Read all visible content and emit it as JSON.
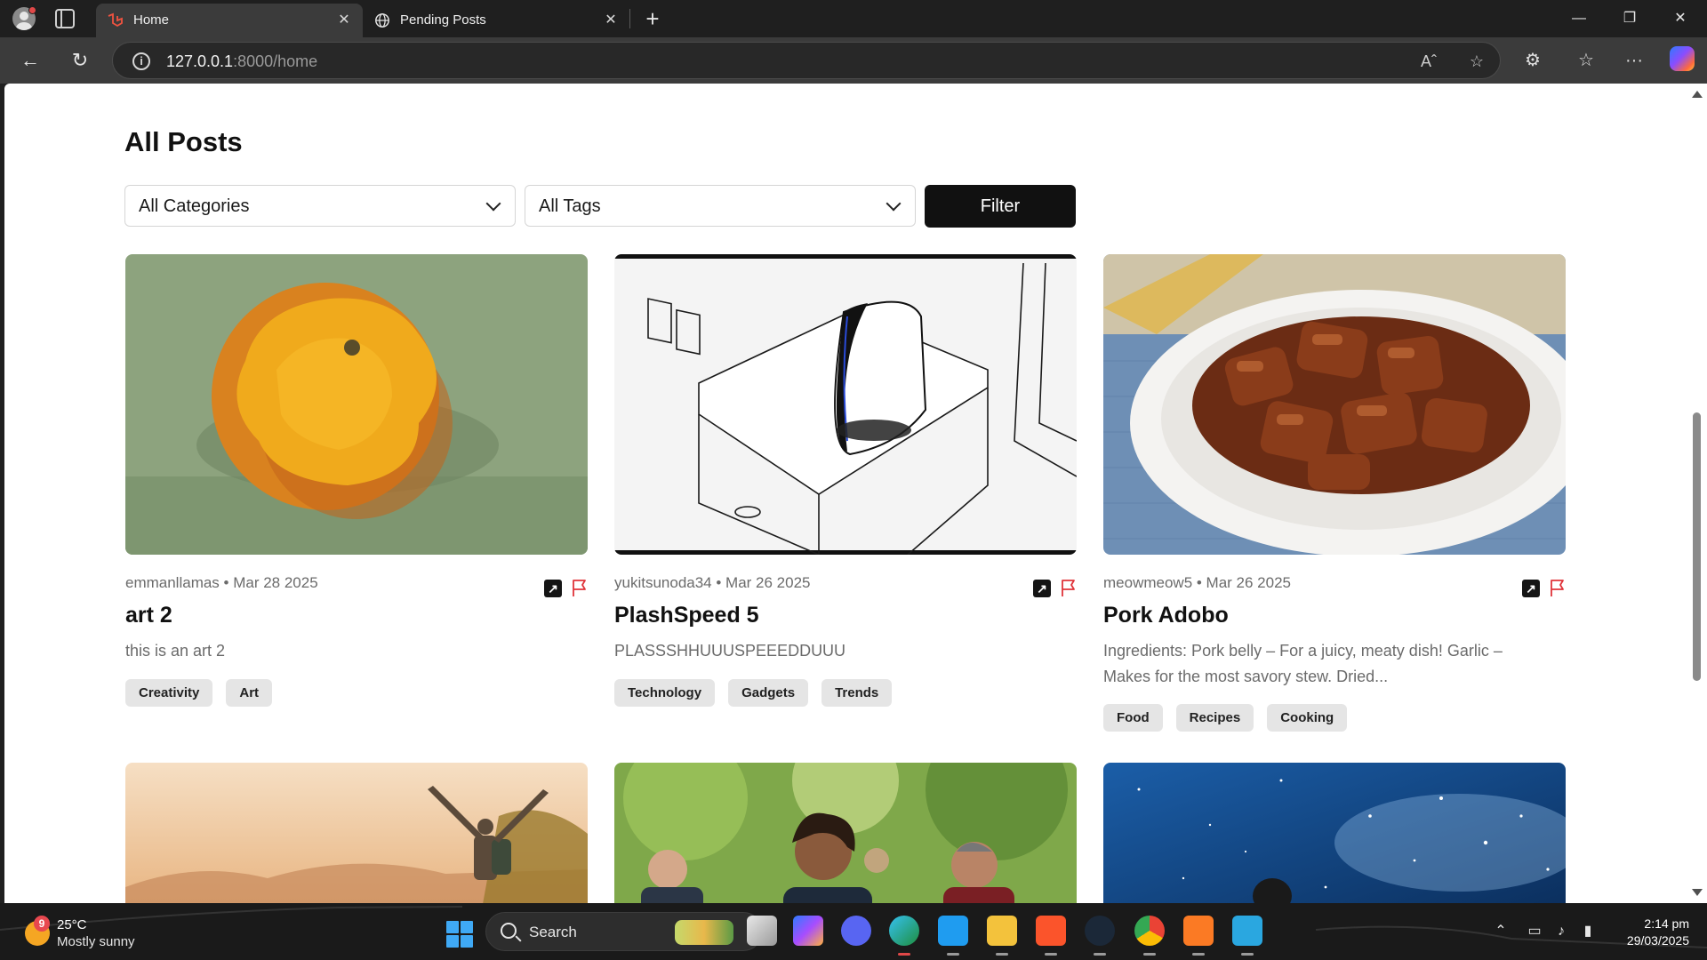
{
  "browser": {
    "tabs": [
      {
        "title": "Home",
        "active": true,
        "icon": "laravel-icon"
      },
      {
        "title": "Pending Posts",
        "active": false,
        "icon": "globe-icon"
      }
    ],
    "url_host": "127.0.0.1",
    "url_rest": ":8000/home"
  },
  "page": {
    "title": "All Posts",
    "filters": {
      "category_selected": "All Categories",
      "tag_selected": "All Tags",
      "button_label": "Filter"
    },
    "posts": [
      {
        "meta": "emmanllamas • Mar 28 2025",
        "title": "art 2",
        "description": "this is an art 2",
        "tags": [
          "Creativity",
          "Art"
        ]
      },
      {
        "meta": "yukitsunoda34 • Mar 26 2025",
        "title": "PlashSpeed 5",
        "description": "PLASSSHHUUUSPEEEDDUUU",
        "tags": [
          "Technology",
          "Gadgets",
          "Trends"
        ]
      },
      {
        "meta": "meowmeow5 • Mar 26 2025",
        "title": "Pork Adobo",
        "description": "Ingredients: Pork belly – For a juicy, meaty dish! Garlic – Makes for the most savory stew. Dried...",
        "tags": [
          "Food",
          "Recipes",
          "Cooking"
        ]
      }
    ]
  },
  "taskbar": {
    "weather_temp": "25°C",
    "weather_desc": "Mostly sunny",
    "weather_badge": "9",
    "search_label": "Search",
    "time": "2:14 pm",
    "date": "29/03/2025"
  },
  "colors": {
    "filter_button": "#111111",
    "tag_bg": "#e5e5e5",
    "flag_red": "#e0343a",
    "browser_chrome": "#3b3b3b"
  }
}
